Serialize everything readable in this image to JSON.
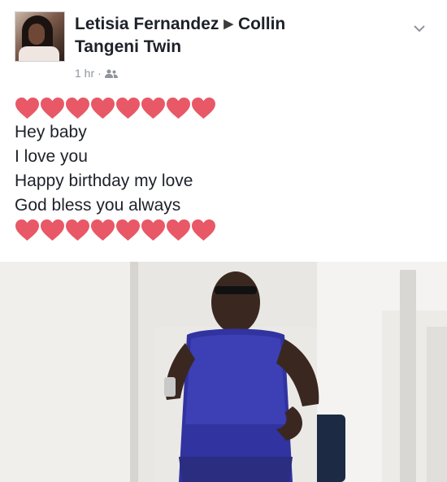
{
  "post": {
    "author": "Letisia Fernandez",
    "recipient_line1": "Collin",
    "recipient_line2": "Tangeni Twin",
    "time": "1 hr",
    "audience_icon": "friends-icon",
    "menu_icon": "chevron-down-icon"
  },
  "message": {
    "heart_color": "#e85866",
    "hearts_top_count": 8,
    "hearts_bottom_count": 8,
    "lines": [
      "Hey baby",
      "I love you",
      "Happy birthday my love",
      "God bless you always"
    ]
  }
}
